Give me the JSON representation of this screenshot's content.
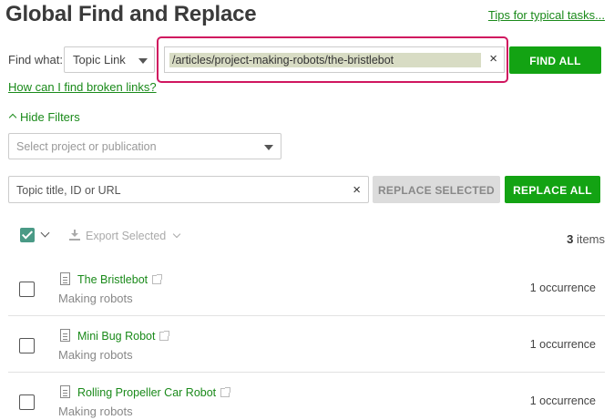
{
  "header": {
    "title": "Global Find and Replace",
    "tips_link": "Tips for typical tasks..."
  },
  "find": {
    "label": "Find what:",
    "type_selected": "Topic Link",
    "value": "/articles/project-making-robots/the-bristlebot",
    "clear_symbol": "×",
    "find_all_label": "FIND ALL",
    "broken_links_help": "How can I find broken links?"
  },
  "filters": {
    "toggle_label": "Hide Filters",
    "project_placeholder": "Select project or publication"
  },
  "replace": {
    "placeholder": "Topic title, ID or URL",
    "clear_symbol": "×",
    "replace_selected_label": "REPLACE SELECTED",
    "replace_all_label": "REPLACE ALL"
  },
  "results": {
    "export_label": "Export Selected",
    "count": "3",
    "count_suffix": "items",
    "rows": [
      {
        "title": "The Bristlebot",
        "subtitle": "Making robots",
        "occurrences": "1 occurrence"
      },
      {
        "title": "Mini Bug Robot",
        "subtitle": "Making robots",
        "occurrences": "1 occurrence"
      },
      {
        "title": "Rolling Propeller Car Robot",
        "subtitle": "Making robots",
        "occurrences": "1 occurrence"
      }
    ]
  },
  "colors": {
    "accent_green": "#13a313",
    "link_green": "#1a8a1a",
    "highlight_border": "#d0165f",
    "checkbox_checked": "#4a9a86"
  }
}
